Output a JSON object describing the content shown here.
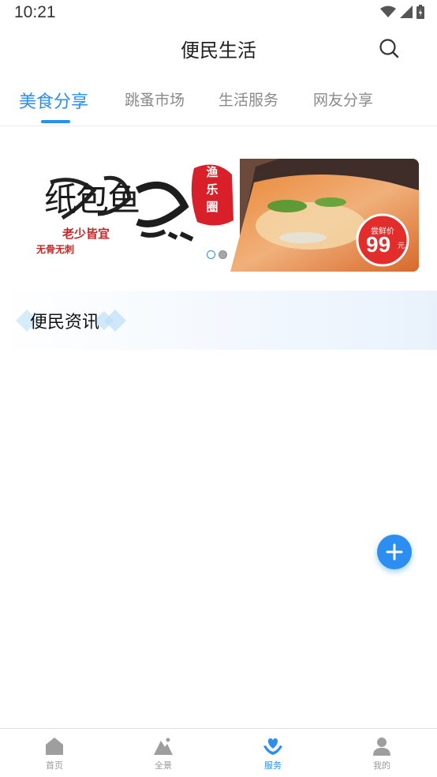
{
  "status_bar": {
    "time": "10:21",
    "icons": [
      "wifi-icon",
      "signal-icon",
      "battery-icon"
    ]
  },
  "app_bar": {
    "title": "便民生活",
    "search_icon": "search-icon"
  },
  "tabs": [
    {
      "label": "美食分享",
      "active": true
    },
    {
      "label": "跳蚤市场",
      "active": false
    },
    {
      "label": "生活服务",
      "active": false
    },
    {
      "label": "网友分享",
      "active": false
    }
  ],
  "banner": {
    "headline": "纸包鱼",
    "slogan": "老少皆宜",
    "tagline": "无骨无刺",
    "seal": [
      "渔",
      "乐",
      "圈"
    ],
    "price_label": "尝鲜价",
    "price": "99",
    "price_unit": "元",
    "slides": 2,
    "current_slide": 1
  },
  "news": {
    "title": "便民资讯"
  },
  "fab": {
    "icon": "plus-icon"
  },
  "bottom_nav": [
    {
      "label": "首页",
      "icon": "home-icon",
      "active": false
    },
    {
      "label": "全景",
      "icon": "panorama-icon",
      "active": false
    },
    {
      "label": "服务",
      "icon": "service-icon",
      "active": true
    },
    {
      "label": "我的",
      "icon": "user-icon",
      "active": false
    }
  ],
  "colors": {
    "accent": "#2b8ef0",
    "inactive_text": "#8a8a8a",
    "seal_red": "#d9202a"
  }
}
